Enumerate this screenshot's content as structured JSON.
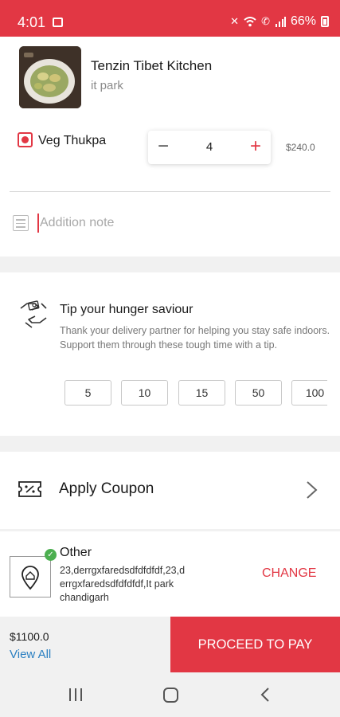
{
  "status_bar": {
    "time": "4:01",
    "battery": "66%"
  },
  "restaurant": {
    "name": "Tenzin Tibet Kitchen",
    "location": "it park"
  },
  "cart_item": {
    "name": "Veg Thukpa",
    "quantity": "4",
    "price": "$240.0",
    "minus_symbol": "−",
    "plus_symbol": "+"
  },
  "note": {
    "placeholder": "Addition note"
  },
  "tip": {
    "title": "Tip your hunger saviour",
    "description": "Thank your delivery partner for helping you stay safe indoors. Support them through these tough time with a tip.",
    "options": [
      "5",
      "10",
      "15",
      "50",
      "100"
    ]
  },
  "coupon": {
    "label": "Apply Coupon"
  },
  "address": {
    "type": "Other",
    "lines": [
      "23,derrgxfaredsdfdfdfdf,23,d",
      "errgxfaredsdfdfdfdf,It park",
      "chandigarh"
    ],
    "change_label": "CHANGE"
  },
  "checkout": {
    "total": "$1100.0",
    "view_all_label": "View All",
    "proceed_label": "PROCEED TO PAY"
  },
  "colors": {
    "accent": "#e23744",
    "link": "#2a7fc1",
    "success": "#4caf50",
    "band": "#f1f1f1"
  },
  "icons": [
    "gallery-icon",
    "mute-icon",
    "wifi-icon",
    "wifi-calling-icon",
    "signal-icon",
    "battery-icon",
    "note-icon",
    "tip-hands-icon",
    "coupon-icon",
    "chevron-right-icon",
    "location-pin-icon",
    "check-icon",
    "nav-recents-icon",
    "nav-home-icon",
    "nav-back-icon"
  ]
}
